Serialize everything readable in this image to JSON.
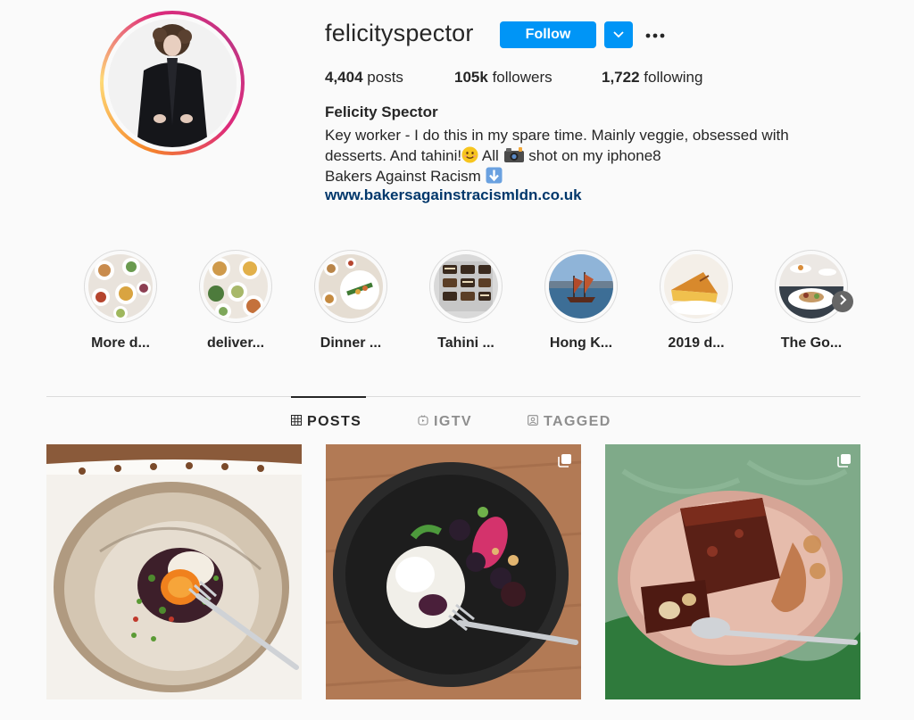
{
  "profile": {
    "username": "felicityspector",
    "follow_label": "Follow",
    "stats": {
      "posts_count": "4,404",
      "posts_label": "posts",
      "followers_count": "105k",
      "followers_label": "followers",
      "following_count": "1,722",
      "following_label": "following"
    },
    "full_name": "Felicity Spector",
    "bio": {
      "line1": "Key worker - I do this in my spare time. Mainly veggie, obsessed with",
      "line2_a": "desserts. And tahini!",
      "line2_b": " All ",
      "line2_c": " shot on my iphone8",
      "line3": "Bakers Against Racism ",
      "link": "www.bakersagainstracismldn.co.uk"
    }
  },
  "highlights": [
    {
      "label": "More d..."
    },
    {
      "label": "deliver..."
    },
    {
      "label": "Dinner ..."
    },
    {
      "label": "Tahini ..."
    },
    {
      "label": "Hong K..."
    },
    {
      "label": "2019 d..."
    },
    {
      "label": "The Go..."
    }
  ],
  "tabs": {
    "posts": "POSTS",
    "igtv": "IGTV",
    "tagged": "TAGGED"
  },
  "icons": {
    "dropdown": "chevron-down-icon",
    "more": "more-options-icon",
    "next": "chevron-right-icon",
    "grid": "grid-icon",
    "igtv": "igtv-icon",
    "tagged": "tagged-icon",
    "multi": "multiple-posts-icon"
  },
  "colors": {
    "accent": "#0095f6",
    "link": "#00376b",
    "text": "#262626",
    "muted": "#8e8e8e",
    "background": "#fafafa"
  }
}
